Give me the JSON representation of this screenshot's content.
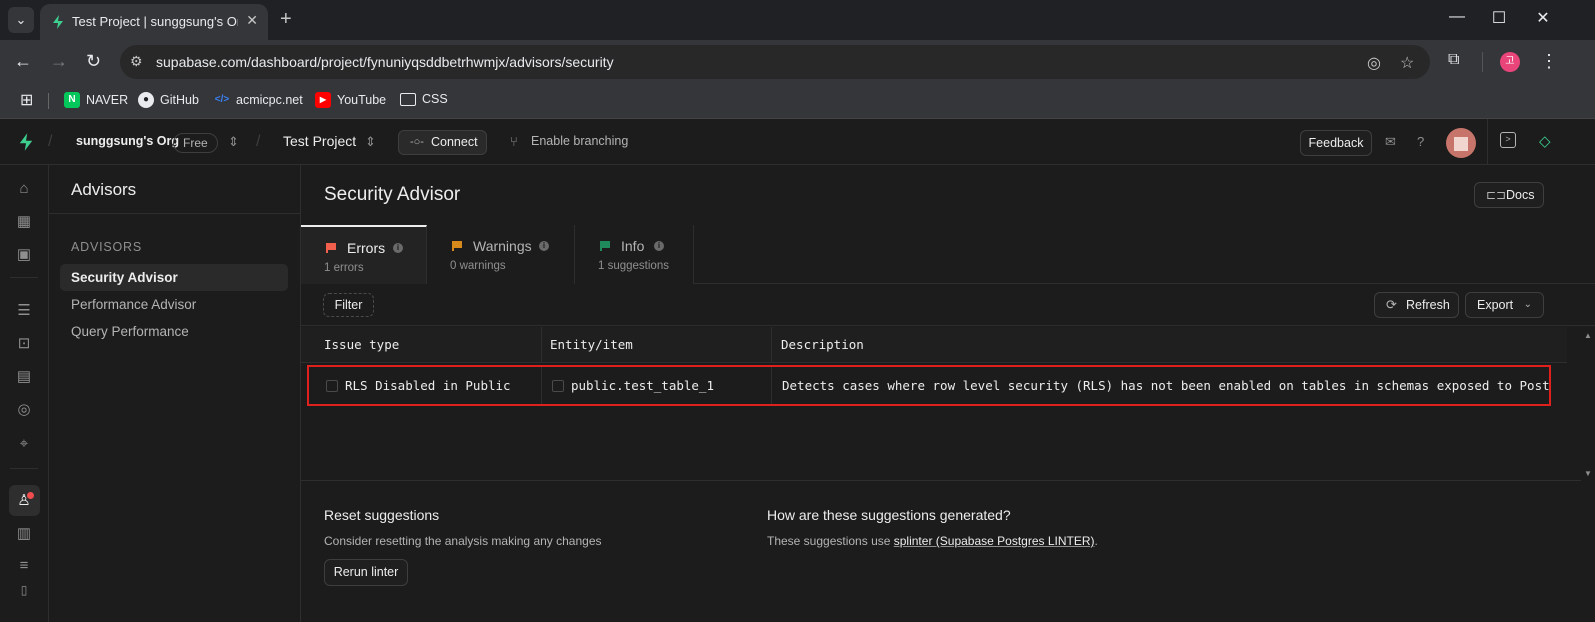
{
  "browser": {
    "tab_title": "Test Project | sunggsung's Org",
    "url": "supabase.com/dashboard/project/fynuniyqsddbetrhwmjx/advisors/security",
    "profile_initial": "고",
    "bookmarks": [
      {
        "label": "NAVER",
        "icon": "naver-icon"
      },
      {
        "label": "GitHub",
        "icon": "github-icon"
      },
      {
        "label": "acmicpc.net",
        "icon": "code-icon"
      },
      {
        "label": "YouTube",
        "icon": "youtube-icon"
      },
      {
        "label": "CSS",
        "icon": "folder-icon"
      }
    ]
  },
  "topbar": {
    "org_name": "sunggsung's Org",
    "plan_badge": "Free",
    "project_name": "Test Project",
    "connect_label": "Connect",
    "branching_label": "Enable branching",
    "feedback_label": "Feedback"
  },
  "sidebar": {
    "title": "Advisors",
    "section": "ADVISORS",
    "items": [
      {
        "label": "Security Advisor",
        "active": true
      },
      {
        "label": "Performance Advisor",
        "active": false
      },
      {
        "label": "Query Performance",
        "active": false
      }
    ]
  },
  "main": {
    "title": "Security Advisor",
    "docs_label": "Docs",
    "tabs": [
      {
        "label": "Errors",
        "sub": "1 errors",
        "color": "#f0604d"
      },
      {
        "label": "Warnings",
        "sub": "0 warnings",
        "color": "#d68a1c"
      },
      {
        "label": "Info",
        "sub": "1 suggestions",
        "color": "#1f8a5b"
      }
    ],
    "filter_label": "Filter",
    "refresh_label": "Refresh",
    "export_label": "Export",
    "columns": [
      "Issue type",
      "Entity/item",
      "Description"
    ],
    "rows": [
      {
        "issue_type": "RLS Disabled in Public",
        "entity": "public.test_table_1",
        "description": "Detects cases where row level security (RLS) has not been enabled on tables in schemas exposed to PostgREST"
      }
    ]
  },
  "footer": {
    "reset_title": "Reset suggestions",
    "reset_desc": "Consider resetting the analysis making any changes",
    "rerun_label": "Rerun linter",
    "how_title": "How are these suggestions generated?",
    "how_desc_prefix": "These suggestions use ",
    "how_link": "splinter (Supabase Postgres LINTER)",
    "how_desc_suffix": "."
  }
}
